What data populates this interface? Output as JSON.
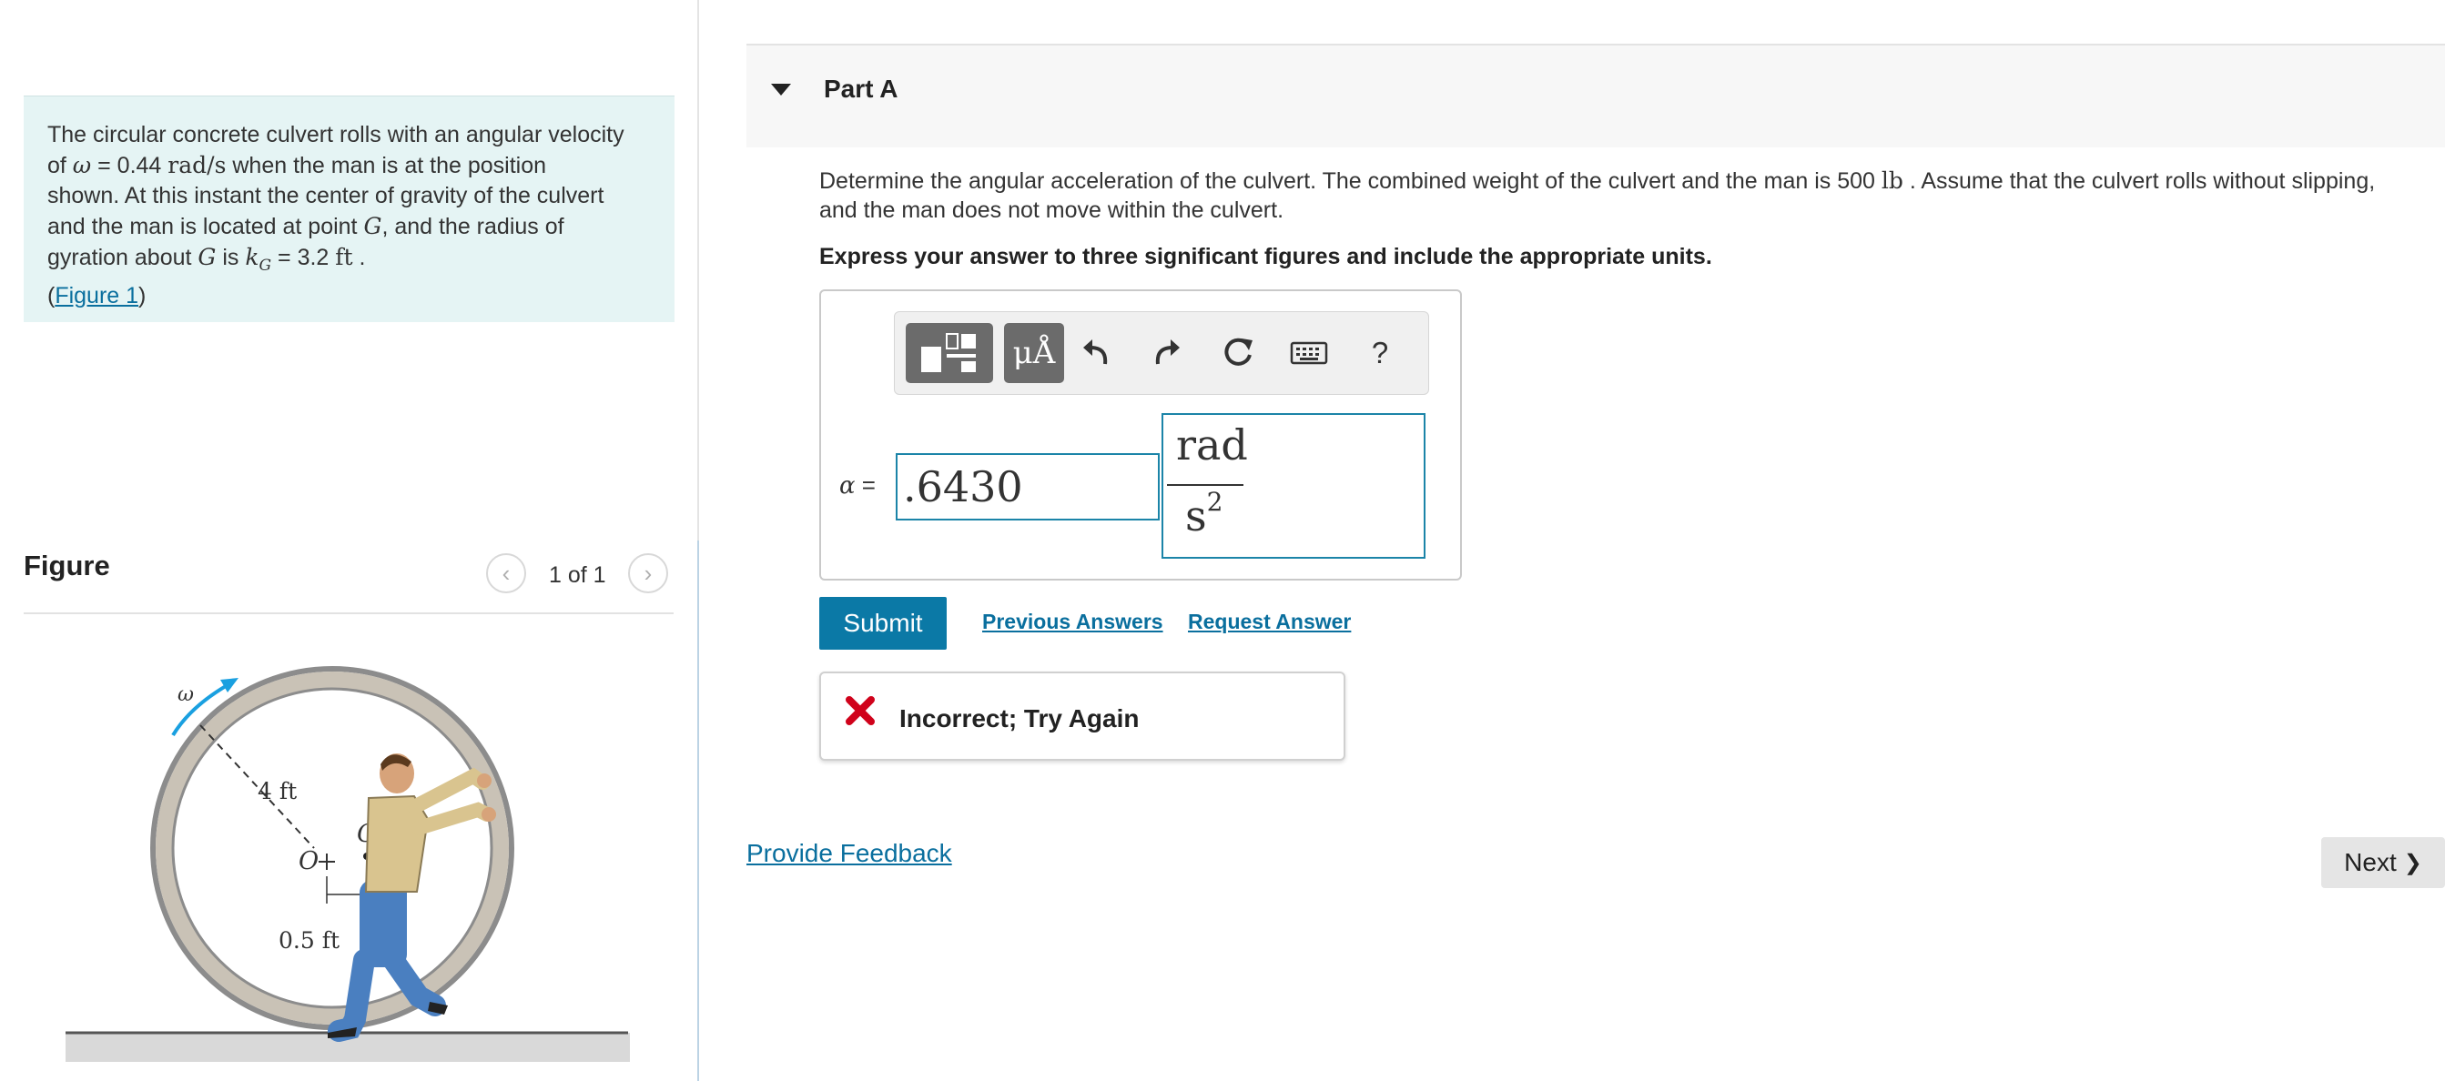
{
  "problem": {
    "line1": "The circular concrete culvert rolls with an angular velocity",
    "line2_prefix": "of ",
    "omega_symbol": "ω",
    "line2_eq": " = 0.44 ",
    "omega_unit": "rad/s",
    "line2_suffix": " when the man is at the position",
    "line3": "shown. At this instant the center of gravity of the culvert",
    "line4_prefix": "and the man is located at point ",
    "point_symbol": "G",
    "line4_suffix": ", and the radius of",
    "line5_prefix": "gyration about ",
    "line5_g": "G",
    "line5_is": " is ",
    "kg_symbol": "k",
    "kg_sub": "G",
    "kg_eq": " = 3.2 ",
    "kg_unit": "ft",
    "line5_end": " .",
    "figure_link_open": "(",
    "figure_link": "Figure 1",
    "figure_link_close": ")"
  },
  "figure": {
    "title": "Figure",
    "pager_prev": "‹",
    "pager_count": "1 of 1",
    "pager_next": "›",
    "labels": {
      "omega": "ω",
      "radius": "4 ft",
      "center": "O",
      "g": "G",
      "offset": "0.5 ft"
    }
  },
  "part": {
    "title": "Part A",
    "question_a": "Determine the angular acceleration of the culvert. The combined weight of the culvert and the man is 500 ",
    "question_unit": "lb",
    "question_b": " . Assume that the culvert rolls without slipping,",
    "question_c": "and the man does not move within the culvert.",
    "instruction": "Express your answer to three significant figures and include the appropriate units."
  },
  "answer": {
    "toolbar": {
      "units_button": "μÅ",
      "help": "?"
    },
    "alpha_symbol": "α",
    "alpha_eq": " =",
    "value": ".6430",
    "unit_numerator": "rad",
    "unit_denominator": "s",
    "unit_exponent": "2"
  },
  "actions": {
    "submit": "Submit",
    "previous_answers": "Previous Answers",
    "request_answer": "Request Answer"
  },
  "feedback": {
    "message": "Incorrect; Try Again",
    "error_color": "#d0021b"
  },
  "footer": {
    "provide_feedback": "Provide Feedback",
    "next": "Next",
    "next_chevron": "❯"
  }
}
